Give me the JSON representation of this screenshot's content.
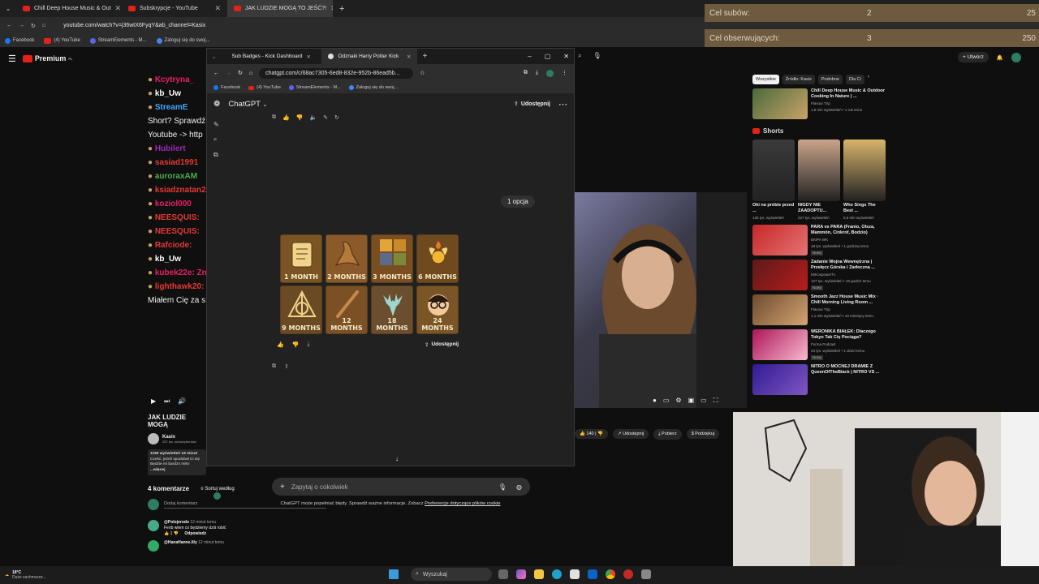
{
  "browser": {
    "tabs": [
      {
        "label": "Chill Deep House Music & Out"
      },
      {
        "label": "Subskrypcje - YouTube"
      },
      {
        "label": "JAK LUDZIE MOGĄ TO JEŚĆ?!"
      }
    ],
    "url": "youtube.com/watch?v=j36wtX6FyqY&ab_channel=Kasix",
    "bookmarks": [
      "Facebook",
      "(4) YouTube",
      "StreamElements - M...",
      "Zaloguj się do swoj..."
    ]
  },
  "overlay": {
    "goal1": {
      "label": "Cel subów:",
      "current": "2",
      "target": "25"
    },
    "goal2": {
      "label": "Cel obserwujących:",
      "current": "3",
      "target": "250"
    }
  },
  "youtube": {
    "logo": "Premium",
    "logo_sup": "PL",
    "create": "Utwórz",
    "chat": [
      {
        "user": "Kcytryna_",
        "color": "#e91e63"
      },
      {
        "user": "kb_Uw",
        "color": "#ffffff"
      },
      {
        "user": "StreamE",
        "color": "#3ea6ff"
      },
      {
        "text": "Short? Sprawdź"
      },
      {
        "text": "Youtube -> http"
      },
      {
        "user": "Hubilert",
        "color": "#9c27b0"
      },
      {
        "user": "sasiad1991",
        "color": "#e53935"
      },
      {
        "user": "auroraxAM",
        "color": "#4caf50"
      },
      {
        "user": "ksiadznatan21",
        "color": "#e53935"
      },
      {
        "user": "koziol000",
        "color": "#e91e63"
      },
      {
        "user": "NEESQUIS:",
        "color": "#e53935"
      },
      {
        "user": "NEESQUIS:",
        "color": "#e53935"
      },
      {
        "user": "Rafciode:",
        "color": "#e53935"
      },
      {
        "user": "kb_Uw",
        "color": "#ffffff"
      },
      {
        "user": "kubek22e: Zno",
        "color": "#e91e63"
      },
      {
        "user": "lighthawk20:",
        "color": "#e53935"
      },
      {
        "text": "Miałem Cię za s"
      }
    ],
    "video_title": "JAK LUDZIE MOGĄ",
    "channel": "Kasix",
    "subs": "257 tys. subskrybentów",
    "desc": [
      "1190 wyświetleń 19 minut",
      "Cześć, jeżeli spodobał Ci się",
      "Będzie mi bardzo miło!",
      "...więcej"
    ],
    "likes": "140",
    "actions": [
      "Udostępnij",
      "Pobierz",
      "Podziękuj"
    ],
    "chips": [
      "Wszystkie",
      "Źródło: Kasix",
      "Podobne",
      "Dla Ci"
    ],
    "shorts_title": "Shorts",
    "rec_top": {
      "title": "Chill Deep House Music & Outdoor Cooking In Nature | ...",
      "channel": "Flavour Trip",
      "meta": "1,8 mln wyświetleń • 1 rok temu",
      "duration": "2:08:28"
    },
    "shorts": [
      {
        "title": "Oki na próbie przed ...",
        "meta": "136 tys. wyświetleń"
      },
      {
        "title": "NIGDY NIE ZAADOPTU...",
        "meta": "227 tys. wyświetleń"
      },
      {
        "title": "Who Sings The Best ...",
        "meta": "5,5 mln wyświetleń"
      }
    ],
    "recs": [
      {
        "title": "PARA vs PARA (Franio, Olsza, Mammón, Cinkrof, Bodzio)",
        "channel": "EKIPA WK",
        "meta": "18 tys. wyświetleń • 1 godzinę temu",
        "tag": "Nowy",
        "duration": "36:55",
        "c1": "#c62828",
        "c2": "#e57373"
      },
      {
        "title": "Zadanie Wojna Wewnętrzna | Przełęcz Górska i Zarłoczna ...",
        "channel": "MrKoxpowerTv",
        "meta": "127 tys. wyświetleń • 18 godzin temu",
        "tag": "Nowy",
        "duration": "32:52",
        "c1": "#5d1a1a",
        "c2": "#b71c1c"
      },
      {
        "title": "Smooth Jazz House Music Mix · Chill Morning Living Room ...",
        "channel": "Flavour Trip",
        "meta": "1,1 mln wyświetleń • 10 miesięcy temu",
        "tag": "",
        "duration": "2:03:47",
        "c1": "#6d4c2f",
        "c2": "#d4a373"
      },
      {
        "title": "WERONIKA BIAŁEK: Dlaczego Tokyo Tak Cię Pociąga?",
        "channel": "Forma Podcast",
        "meta": "23 tys. wyświetleń • 1 dzień temu",
        "tag": "Nowy",
        "duration": "1:03:19",
        "c1": "#ad1457",
        "c2": "#f8bbd0"
      },
      {
        "title": "NITRO O MOCNEJ DRAMIE Z QueenOfTheBlack | NITRO VS ...",
        "channel": "",
        "meta": "",
        "tag": "",
        "duration": "",
        "c1": "#311b92",
        "c2": "#7e57c2"
      }
    ],
    "comments_count": "4 komentarze",
    "sort": "Sortuj według",
    "add_comment": "Dodaj komentarz",
    "comments": [
      {
        "user": "@Polojerodo",
        "time": "12 minut temu",
        "text": "Fenb wiem co będziemy dziś robić",
        "likes": "1",
        "reply": "Odpowiedz"
      },
      {
        "user": "@HanaHanne.lily",
        "time": "12 minut temu",
        "text": ""
      }
    ]
  },
  "chrome2": {
    "tabs": [
      {
        "label": "Sub Badges - Kick Dashboard"
      },
      {
        "label": "Odznaki Harry Potter Kick"
      }
    ],
    "url": "chatgpt.com/c/68ac7305-6ed8-832e-952b-86ead5b...",
    "bookmarks": [
      "Facebook",
      "(4) YouTube",
      "StreamElements - M...",
      "Zaloguj się do swoj..."
    ]
  },
  "chatgpt": {
    "title": "ChatGPT",
    "share": "Udostępnij",
    "bubble": "1 opcja",
    "image_share": "Udostępnij",
    "placeholder": "Zapytaj o cokolwiek",
    "disclaimer": "ChatGPT może popełniać błędy. Sprawdź ważne informacje. Zobacz ",
    "disclaimer_link": "Preferencje dotyczące plików cookie",
    "badges": [
      {
        "label": "1 MONTH",
        "icon": "scroll-icon"
      },
      {
        "label": "2 MONTHS",
        "icon": "sorting-hat-icon"
      },
      {
        "label": "3 MONTHS",
        "icon": "house-crests-icon"
      },
      {
        "label": "6 MONTHS",
        "icon": "golden-snitch-icon"
      },
      {
        "label": "9 MONTHS",
        "icon": "deathly-hallows-icon"
      },
      {
        "label": "12 MONTHS",
        "icon": "wand-icon"
      },
      {
        "label": "18 MONTHS",
        "icon": "stag-patronus-icon"
      },
      {
        "label": "24 MONTHS",
        "icon": "harry-face-icon"
      }
    ]
  },
  "taskbar": {
    "weather_temp": "18°C",
    "weather_desc": "Duże zachmurze...",
    "search": "Wyszukaj"
  }
}
